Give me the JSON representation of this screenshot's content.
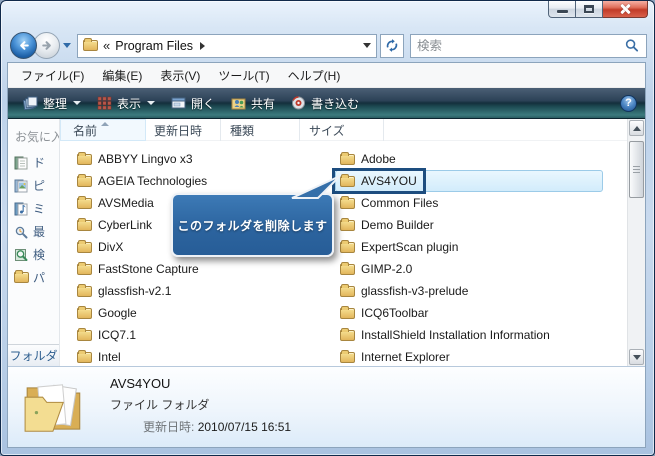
{
  "navbar": {
    "breadcrumb_collapse": "«",
    "breadcrumb_path": "Program Files",
    "search_placeholder": "検索"
  },
  "menubar": {
    "file": "ファイル(F)",
    "edit": "編集(E)",
    "view": "表示(V)",
    "tools": "ツール(T)",
    "help": "ヘルプ(H)"
  },
  "toolbar": {
    "organize": "整理",
    "views": "表示",
    "open": "開く",
    "share": "共有",
    "burn": "書き込む",
    "help_glyph": "?"
  },
  "sidebar": {
    "header": "お気に入",
    "items": [
      {
        "label": "ド"
      },
      {
        "label": "ピ"
      },
      {
        "label": "ミ"
      },
      {
        "label": "最"
      },
      {
        "label": "検"
      },
      {
        "label": "パ"
      }
    ],
    "footer": "フォルダ"
  },
  "list": {
    "columns": [
      "名前",
      "更新日時",
      "種類",
      "サイズ"
    ],
    "left": [
      "ABBYY Lingvo x3",
      "AGEIA Technologies",
      "AVSMedia",
      "CyberLink",
      "DivX",
      "FastStone Capture",
      "glassfish-v2.1",
      "Google",
      "ICQ7.1",
      "Intel"
    ],
    "right": [
      "Adobe",
      "AVS4YOU",
      "Common Files",
      "Demo Builder",
      "ExpertScan plugin",
      "GIMP-2.0",
      "glassfish-v3-prelude",
      "ICQ6Toolbar",
      "InstallShield Installation Information",
      "Internet Explorer"
    ],
    "selected_item": "AVS4YOU"
  },
  "callout": {
    "text": "このフォルダを削除します"
  },
  "details": {
    "name": "AVS4YOU",
    "type": "ファイル フォルダ",
    "modified_label": "更新日時:",
    "modified_value": "2010/07/15 16:51"
  },
  "colors": {
    "callout_bg": "#2c649f",
    "annotation_border": "#1d4d7f",
    "selection_border": "#9ccbe8",
    "toolbar_teal": "#3c7a7e",
    "close_button_red": "#c23b28"
  }
}
